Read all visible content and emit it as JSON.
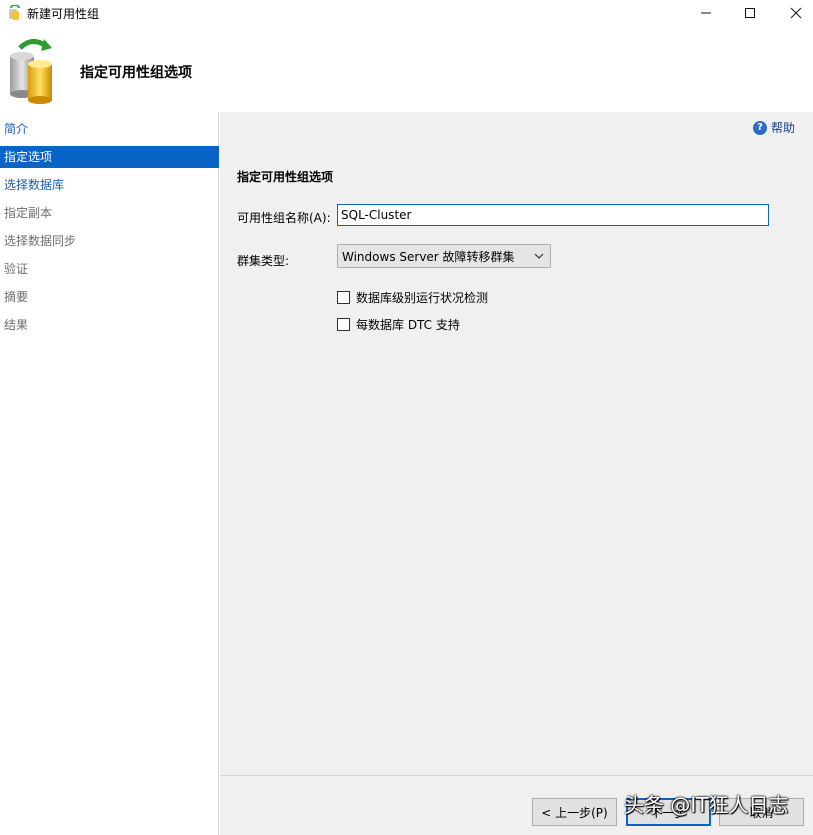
{
  "window": {
    "title": "新建可用性组",
    "minimize_icon": "minimize-icon",
    "maximize_icon": "maximize-icon",
    "close_icon": "close-icon"
  },
  "header": {
    "title": "指定可用性组选项",
    "icon": "database-sync-icon"
  },
  "sidebar": {
    "items": [
      {
        "label": "简介",
        "state": "link"
      },
      {
        "label": "指定选项",
        "state": "active"
      },
      {
        "label": "选择数据库",
        "state": "link"
      },
      {
        "label": "指定副本",
        "state": "disabled"
      },
      {
        "label": "选择数据同步",
        "state": "disabled"
      },
      {
        "label": "验证",
        "state": "disabled"
      },
      {
        "label": "摘要",
        "state": "disabled"
      },
      {
        "label": "结果",
        "state": "disabled"
      }
    ]
  },
  "main": {
    "help_label": "帮助",
    "section_title": "指定可用性组选项",
    "name_label": "可用性组名称(A):",
    "name_value": "SQL-Cluster",
    "type_label": "群集类型:",
    "type_value": "Windows Server 故障转移群集",
    "checkbox_health": {
      "label": "数据库级别运行状况检测",
      "checked": false
    },
    "checkbox_dtc": {
      "label": "每数据库 DTC 支持",
      "checked": false
    }
  },
  "footer": {
    "prev_label": "< 上一步(P)",
    "next_label": "下一步",
    "cancel_label": "取消"
  },
  "watermark": "头条 @IT狂人日志",
  "colors": {
    "accent": "#0a64c8",
    "link": "#1a5fb4",
    "panel_bg": "#f0f0f0"
  }
}
